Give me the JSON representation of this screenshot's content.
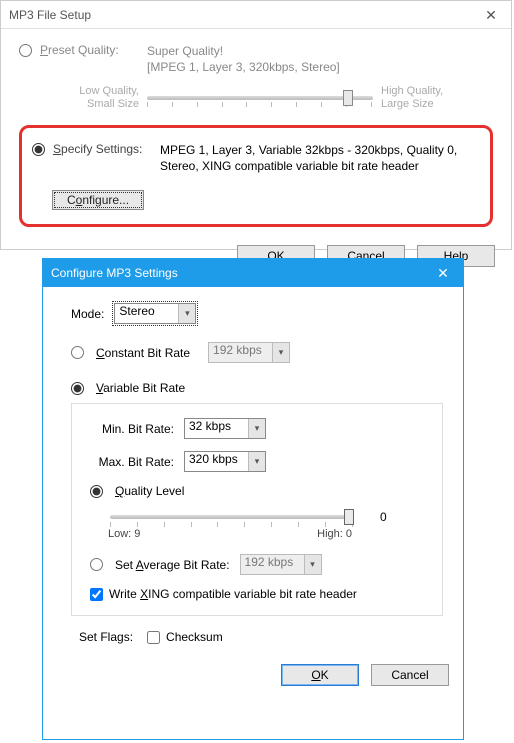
{
  "dialog1": {
    "title": "MP3 File Setup",
    "preset_label": "Preset Quality:",
    "preset_desc1": "Super Quality!",
    "preset_desc2": "[MPEG 1, Layer 3, 320kbps, Stereo]",
    "slider_left1": "Low Quality,",
    "slider_left2": "Small Size",
    "slider_right1": "High Quality,",
    "slider_right2": "Large Size",
    "specify_label": "Specify Settings:",
    "specify_desc": "MPEG 1, Layer 3, Variable 32kbps - 320kbps, Quality 0, Stereo, XING compatible variable bit rate header",
    "configure_btn": "Configure...",
    "ok": "OK",
    "cancel": "Cancel",
    "help": "Help"
  },
  "dialog2": {
    "title": "Configure MP3 Settings",
    "mode_label": "Mode:",
    "mode_value": "Stereo",
    "cbr_label": "Constant Bit Rate",
    "cbr_value": "192 kbps",
    "vbr_label": "Variable Bit Rate",
    "min_label": "Min. Bit Rate:",
    "min_value": "32 kbps",
    "max_label": "Max. Bit Rate:",
    "max_value": "320 kbps",
    "quality_label": "Quality Level",
    "quality_value": "0",
    "q_low_label": "Low: 9",
    "q_high_label": "High: 0",
    "avg_label": "Set Average Bit Rate:",
    "avg_value": "192 kbps",
    "xing_label": "Write XING compatible variable bit rate header",
    "flags_label": "Set Flags:",
    "checksum_label": "Checksum",
    "ok": "OK",
    "cancel": "Cancel"
  }
}
